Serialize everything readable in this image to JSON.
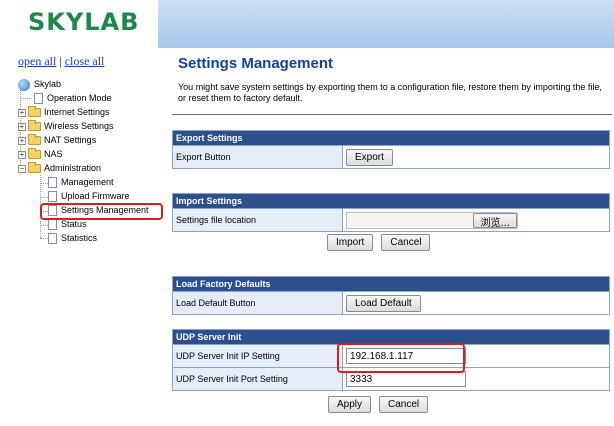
{
  "brand": {
    "logo_text": "SKYLAB"
  },
  "tree": {
    "open_all": "open all",
    "separator": "|",
    "close_all": "close all",
    "root": "Skylab",
    "items": [
      {
        "label": "Operation Mode",
        "type": "page"
      },
      {
        "label": "Internet Settings",
        "type": "folder"
      },
      {
        "label": "Wireless Settings",
        "type": "folder"
      },
      {
        "label": "NAT Settings",
        "type": "folder"
      },
      {
        "label": "NAS",
        "type": "folder"
      },
      {
        "label": "Administration",
        "type": "folder",
        "expanded": true
      },
      {
        "label": "Management",
        "type": "page"
      },
      {
        "label": "Upload Firmware",
        "type": "page"
      },
      {
        "label": "Settings Management",
        "type": "page",
        "highlighted": true
      },
      {
        "label": "Status",
        "type": "page"
      },
      {
        "label": "Statistics",
        "type": "page"
      }
    ]
  },
  "main": {
    "title": "Settings Management",
    "description": "You might save system settings by exporting them to a configuration file, restore them by importing the file, or reset them to factory default.",
    "export": {
      "header": "Export Settings",
      "label": "Export Button",
      "button": "Export"
    },
    "import": {
      "header": "Import Settings",
      "label": "Settings file location",
      "file_value": "",
      "browse_button": "浏览...",
      "import_button": "Import",
      "cancel_button": "Cancel"
    },
    "factory": {
      "header": "Load Factory Defaults",
      "label": "Load Default Button",
      "button": "Load Default"
    },
    "udp": {
      "header": "UDP Server Init",
      "ip_label": "UDP Server Init IP Setting",
      "ip_value": "192.168.1.117",
      "port_label": "UDP Server Init Port Setting",
      "port_value": "3333",
      "apply_button": "Apply",
      "cancel_button": "Cancel"
    }
  },
  "colors": {
    "logo": "#1b8a49",
    "title": "#0f3fa0",
    "table_header": "#2c4f8e",
    "label_cell": "#e4edf8",
    "highlight": "#d62020",
    "link": "#1a3bbf"
  }
}
